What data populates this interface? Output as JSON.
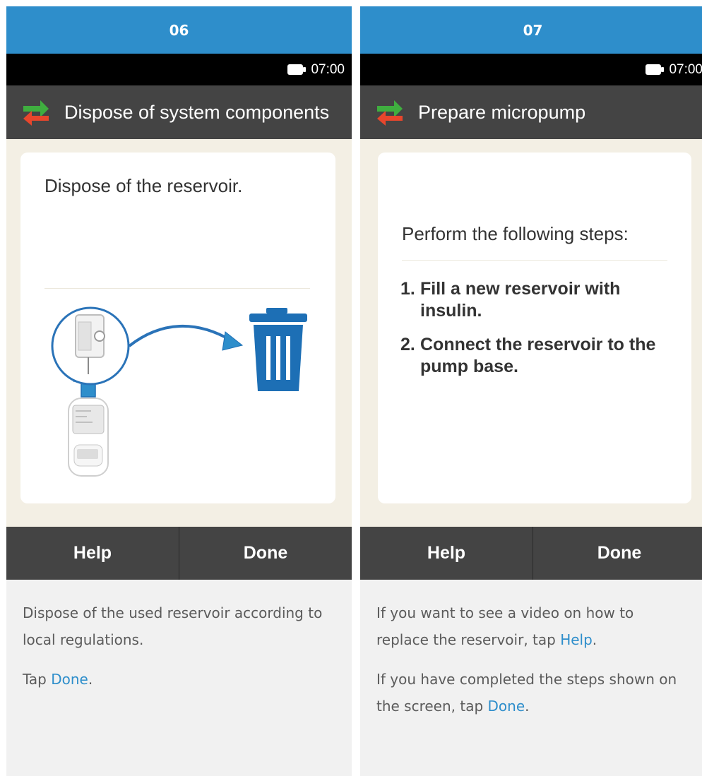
{
  "panels": [
    {
      "step": "06",
      "status": {
        "time": "07:00"
      },
      "title": "Dispose of system components",
      "card": {
        "heading": "Dispose of the reservoir."
      },
      "buttons": {
        "left": "Help",
        "right": "Done"
      },
      "instructions": {
        "p1": "Dispose of the used reservoir according to local regulations.",
        "p2_pre": "Tap ",
        "p2_link": "Done",
        "p2_post": "."
      }
    },
    {
      "step": "07",
      "status": {
        "time": "07:00"
      },
      "title": "Prepare micropump",
      "card": {
        "heading": "Perform the following steps:",
        "steps": [
          {
            "num": "1.",
            "text": "Fill a new reservoir with insulin."
          },
          {
            "num": "2.",
            "text": "Connect the reservoir to the pump base."
          }
        ]
      },
      "buttons": {
        "left": "Help",
        "right": "Done"
      },
      "instructions": {
        "p1_pre": "If you want to see a video on how to replace the reservoir, tap ",
        "p1_link": "Help",
        "p1_post": ".",
        "p2_pre": "If you have completed the steps shown on the screen, tap ",
        "p2_link": "Done",
        "p2_post": "."
      }
    }
  ],
  "icons": [
    "battery-icon",
    "swap-arrows-icon",
    "pump-reservoir-icon",
    "arrow-icon",
    "trash-bin-icon"
  ],
  "colors": {
    "header_blue": "#2e8ecb",
    "bar_dark": "#444444",
    "device_bg": "#f3efe4",
    "arrow_green": "#3fae3f",
    "arrow_red": "#e8462c",
    "trash_blue": "#1d6fb5"
  }
}
